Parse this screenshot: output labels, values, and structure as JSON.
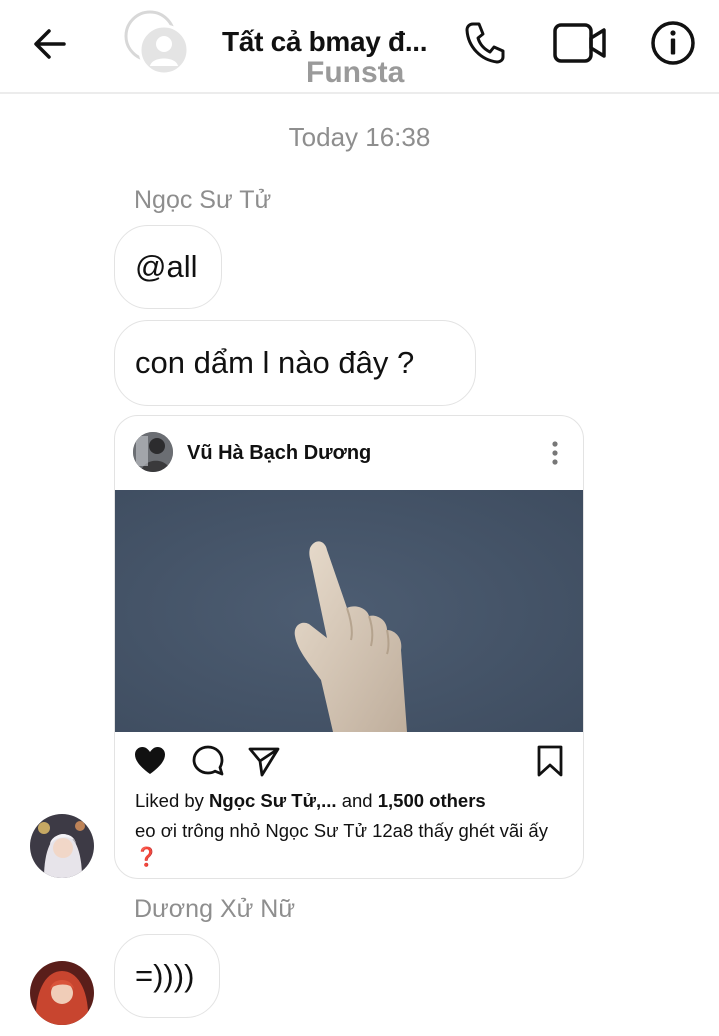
{
  "header": {
    "title": "Tất cả bmay đ...",
    "watermark": "Funsta",
    "icons": [
      "back-arrow-icon",
      "group-avatar-placeholder",
      "phone-icon",
      "video-camera-icon",
      "info-icon"
    ]
  },
  "chat": {
    "timestamp": "Today 16:38",
    "messages": [
      {
        "sender": "Ngọc Sư Tử",
        "text": "@all"
      },
      {
        "text": "con dẩm l nào đây ?"
      }
    ],
    "shared_post": {
      "author": "Vũ Hà Bạch Dương",
      "liked_prefix": "Liked by ",
      "liked_user": "Ngọc Sư Tử,...",
      "liked_mid": " and ",
      "liked_count": "1,500 others",
      "caption": "eo ơi trông nhỏ Ngọc Sư Tử 12a8 thấy ghét vãi ấy",
      "caption_emoji": "❓",
      "colors": {
        "image_bg": "#44546a",
        "emoji": "#e0243a"
      }
    },
    "second_sender": "Dương Xử Nữ",
    "reply": "=))))"
  }
}
